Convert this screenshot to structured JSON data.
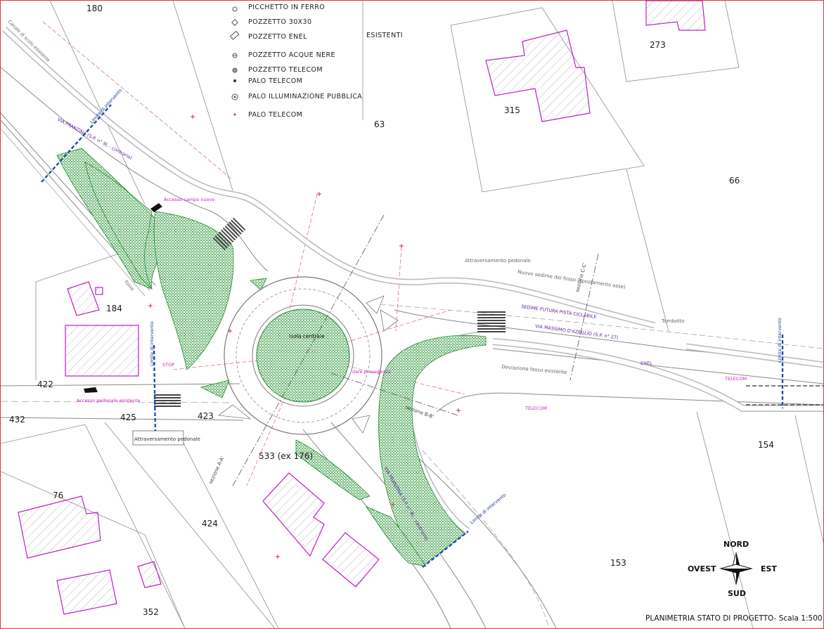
{
  "drawing_title": "PLANIMETRIA STATO DI PROGETTO- Scala 1:500",
  "legend": {
    "items": [
      {
        "label": "PICCHETTO IN FERRO",
        "icon": "iron-stake-icon"
      },
      {
        "label": "POZZETTO 30X30",
        "icon": "manhole-30-icon"
      },
      {
        "label": "POZZETTO ENEL",
        "icon": "enel-manhole-icon"
      },
      {
        "label": "POZZETTO ACQUE NERE",
        "icon": "sewer-manhole-icon"
      },
      {
        "label": "POZZETTO TELECOM",
        "icon": "telecom-manhole-icon"
      },
      {
        "label": "PALO TELECOM",
        "icon": "telecom-pole-icon"
      },
      {
        "label": "PALO ILLUMINAZIONE PUBBLICA",
        "icon": "street-light-icon"
      },
      {
        "label": "PALO TELECOM",
        "icon": "telecom-pole-small-icon"
      }
    ],
    "group_label": "ESISTENTI"
  },
  "parcels": [
    "180",
    "273",
    "63",
    "315",
    "66",
    "184",
    "422",
    "432",
    "425",
    "423",
    "533 (ex 176)",
    "76",
    "424",
    "154",
    "153",
    "352"
  ],
  "labels": {
    "canale": "Canale di scolo esistente",
    "limite": "Limite di intervento",
    "accesso": "Accesso campo nuovo",
    "accesso_ped": "Accesso pedonale esistente",
    "isola": "Isola centrale",
    "attraversamento_left": "Attraversamento pedonale",
    "attraversamento_right": "Attraversamento pedonale",
    "sedime": "Nuovo sedime del fosso (spostamento asse)",
    "deviazione": "Deviazione fosso esistente",
    "tombotto": "Tombotto",
    "sez_a": "sezione A-A'",
    "sez_b": "sezione B-B'",
    "sez_c": "sezione C-C'",
    "via_pranzina_top": "VIA PRANZINA (S.P. n° 9L - contraria)",
    "via_pranzina_bottom": "VIA PRANZINA (S.P. n° 9L - contraria)",
    "via_massimo": "VIA MASSIMO D'AZEGLIO (S.P. n° 27)",
    "pista_ciclabile": "SEDIME FUTURA PISTA CICLABILE",
    "enel": "ENEL",
    "telecom": "TELECOM",
    "stop": "STOP",
    "dare_precedenza": "dare precedenza",
    "fosso": "fosso"
  },
  "compass": {
    "north": "NORD",
    "south": "SUD",
    "east": "EST",
    "west": "OVEST"
  },
  "colors": {
    "frame": "#d63a3a",
    "green": "#1f8a2e",
    "magenta": "#c21fc2",
    "limit": "#1f4fb0",
    "road": "#8a8a8a",
    "dashed": "#d04a4a"
  }
}
